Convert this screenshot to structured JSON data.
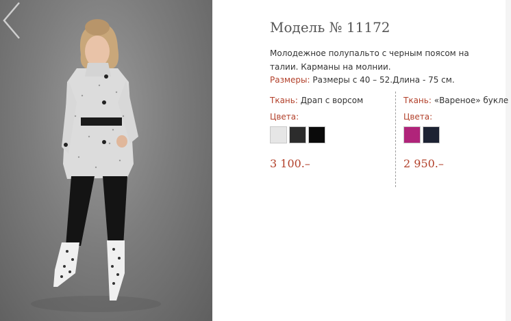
{
  "model": {
    "title": "Модель № 11172"
  },
  "description": "Молодежное полупальто с черным поясом на талии. Карманы на молнии.",
  "sizes": {
    "label": "Размеры:",
    "value": "Размеры с 40 – 52.Длина - 75 см."
  },
  "variants": [
    {
      "fabric_label": "Ткань:",
      "fabric": "Драп с ворсом",
      "colors_label": "Цвета:",
      "swatches": [
        {
          "name": "white-grey",
          "color": "#e6e6e6"
        },
        {
          "name": "dark-grey",
          "color": "#2c2c2c"
        },
        {
          "name": "black",
          "color": "#0a0a0a"
        }
      ],
      "price": "3 100.–"
    },
    {
      "fabric_label": "Ткань:",
      "fabric": "«Вареное» букле",
      "colors_label": "Цвета:",
      "swatches": [
        {
          "name": "magenta",
          "color": "#b0247a"
        },
        {
          "name": "navy",
          "color": "#1c2233"
        }
      ],
      "price": "2 950.–"
    }
  ],
  "icons": {
    "prev": "chevron-left-icon"
  }
}
